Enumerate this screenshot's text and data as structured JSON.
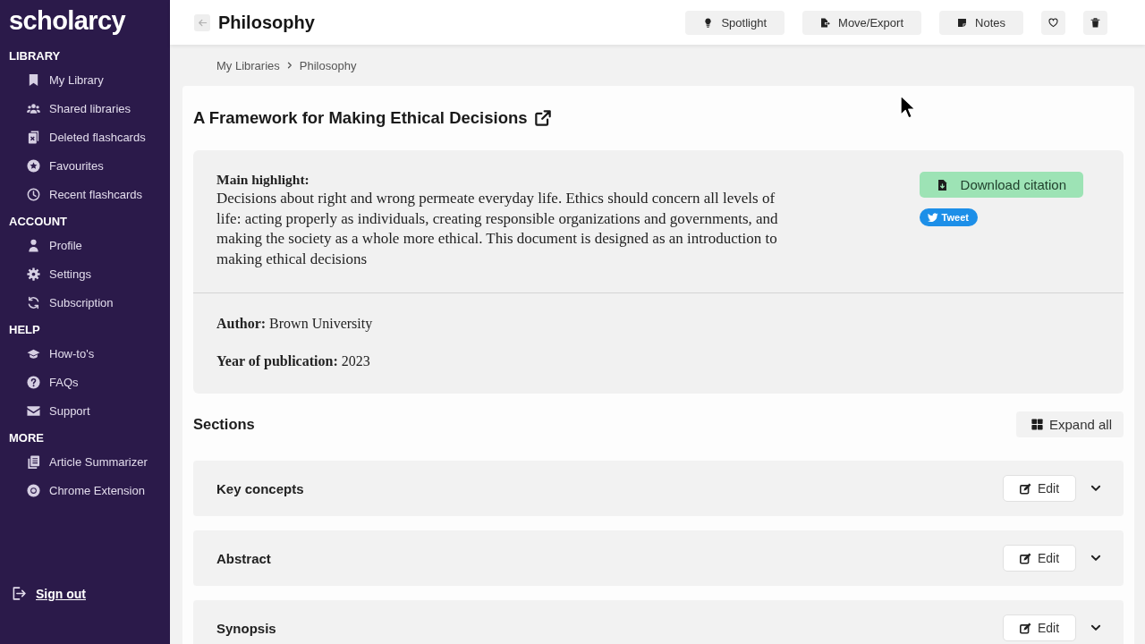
{
  "sidebar": {
    "logo": "scholarcy",
    "sections": [
      {
        "heading": "LIBRARY",
        "items": [
          "My Library",
          "Shared libraries",
          "Deleted flashcards",
          "Favourites",
          "Recent flashcards"
        ]
      },
      {
        "heading": "ACCOUNT",
        "items": [
          "Profile",
          "Settings",
          "Subscription"
        ]
      },
      {
        "heading": "HELP",
        "items": [
          "How-to's",
          "FAQs",
          "Support"
        ]
      },
      {
        "heading": "MORE",
        "items": [
          "Article Summarizer",
          "Chrome Extension"
        ]
      }
    ],
    "sign_out": "Sign out"
  },
  "header": {
    "title": "Philosophy",
    "actions": [
      "Spotlight",
      "Move/Export",
      "Notes"
    ]
  },
  "breadcrumb": [
    "My Libraries",
    "Philosophy"
  ],
  "article": {
    "title": "A Framework for Making Ethical Decisions",
    "highlight_label": "Main highlight:",
    "highlight": "Decisions about right and wrong permeate everyday life. Ethics should concern all levels of life: acting properly as individuals, creating responsible organizations and governments, and making the society as a whole more ethical. This document is designed as an introduction to making ethical decisions",
    "download_citation": "Download citation",
    "tweet": "Tweet",
    "details": [
      "**Author:** Brown University",
      "**Year of publication:** 2023"
    ]
  },
  "sections": {
    "heading": "Sections",
    "expand_all": "Expand all",
    "items": [
      {
        "title": "Key concepts",
        "action": "Edit",
        "expanded": false
      },
      {
        "title": "Abstract",
        "action": "Edit",
        "expanded": false
      },
      {
        "title": "Synopsis",
        "action": "Edit",
        "expanded": false
      }
    ]
  }
}
